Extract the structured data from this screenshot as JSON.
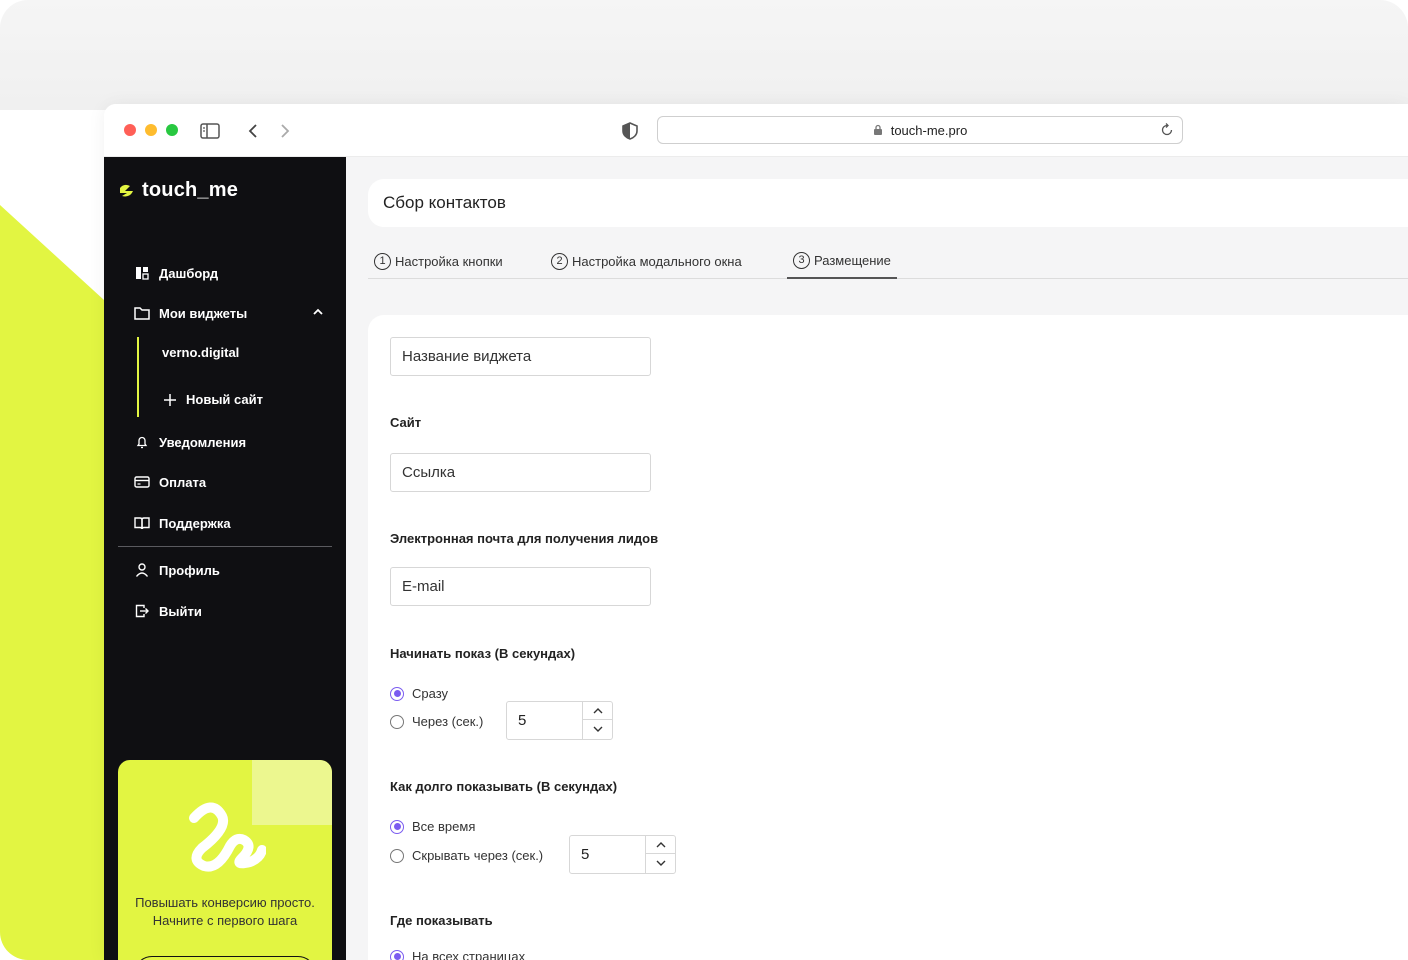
{
  "browser": {
    "url": "touch-me.pro"
  },
  "sidebar": {
    "logo": "touch_me",
    "items": [
      {
        "label": "Дашборд",
        "icon": "dashboard-icon"
      },
      {
        "label": "Мои виджеты",
        "icon": "folder-icon"
      },
      {
        "label": "Уведомления",
        "icon": "bell-icon"
      },
      {
        "label": "Оплата",
        "icon": "card-icon"
      },
      {
        "label": "Поддержка",
        "icon": "book-icon"
      },
      {
        "label": "Профиль",
        "icon": "user-icon"
      },
      {
        "label": "Выйти",
        "icon": "logout-icon"
      }
    ],
    "widgets": [
      "verno.digital"
    ],
    "new_site": "Новый сайт",
    "promo_text": "Повышать конверсию просто. Начните с первого шага"
  },
  "main": {
    "title": "Сбор контактов",
    "tabs": [
      {
        "num": "1",
        "label": "Настройка кнопки"
      },
      {
        "num": "2",
        "label": "Настройка модального окна"
      },
      {
        "num": "3",
        "label": "Размещение"
      }
    ],
    "form": {
      "widget_name": "Название виджета",
      "site_label": "Сайт",
      "site_value": "Ссылка",
      "email_label": "Электронная почта для получения лидов",
      "email_value": "E-mail",
      "start_label": "Начинать показ (В секундах)",
      "start_opt1": "Сразу",
      "start_opt2": "Через (сек.)",
      "start_value": "5",
      "duration_label": "Как долго показывать (В секундах)",
      "duration_opt1": "Все время",
      "duration_opt2": "Скрывать через (сек.)",
      "duration_value": "5",
      "where_label": "Где показывать",
      "where_opt1": "На всех страницах"
    }
  },
  "colors": {
    "accent": "#e2f542",
    "radio": "#7b5cf0",
    "sidebar_bg": "#0f0f12"
  }
}
